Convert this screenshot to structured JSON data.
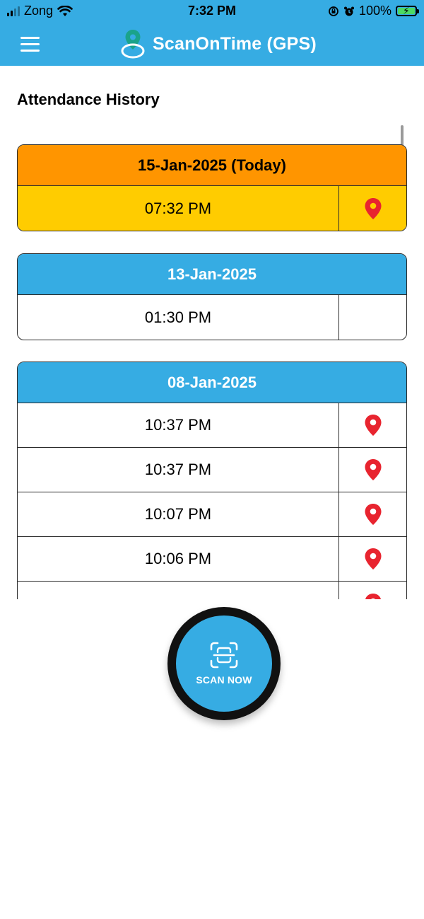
{
  "status_bar": {
    "carrier": "Zong",
    "time": "7:32 PM",
    "battery": "100%"
  },
  "app_bar": {
    "title": "ScanOnTime (GPS)",
    "menu_icon": "hamburger-icon",
    "logo_icon": "location-logo-icon"
  },
  "section_title": "Attendance History",
  "days": [
    {
      "date": "15-Jan-2025 (Today)",
      "today": true,
      "entries": [
        {
          "time": "07:32 PM",
          "has_location": true
        }
      ]
    },
    {
      "date": "13-Jan-2025",
      "today": false,
      "entries": [
        {
          "time": "01:30 PM",
          "has_location": false
        }
      ]
    },
    {
      "date": "08-Jan-2025",
      "today": false,
      "entries": [
        {
          "time": "10:37 PM",
          "has_location": true
        },
        {
          "time": "10:37 PM",
          "has_location": true
        },
        {
          "time": "10:07 PM",
          "has_location": true
        },
        {
          "time": "10:06 PM",
          "has_location": true
        },
        {
          "time": "",
          "has_location": true
        }
      ]
    }
  ],
  "scan_button": {
    "label": "SCAN NOW",
    "icon": "scan-frame-icon"
  },
  "colors": {
    "primary": "#36ace3",
    "today_header": "#ff9500",
    "today_row": "#ffcc00",
    "pin": "#e8242f"
  }
}
